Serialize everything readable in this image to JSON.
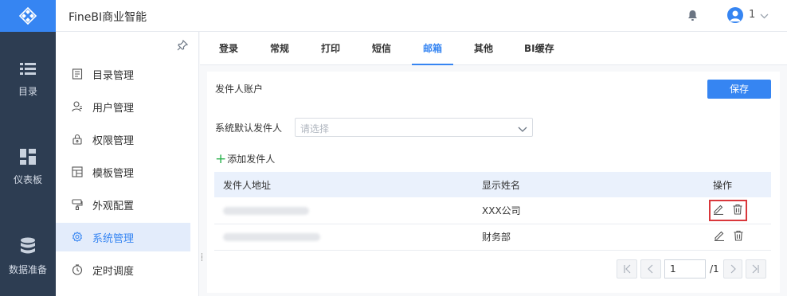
{
  "app": {
    "title": "FineBI商业智能"
  },
  "user": {
    "name": "1"
  },
  "rail": [
    {
      "label": "目录",
      "icon": "list-icon"
    },
    {
      "label": "仪表板",
      "icon": "dashboard-icon"
    },
    {
      "label": "数据准备",
      "icon": "database-icon"
    }
  ],
  "sidebar": {
    "items": [
      {
        "label": "目录管理",
        "icon": "directory-icon"
      },
      {
        "label": "用户管理",
        "icon": "user-icon"
      },
      {
        "label": "权限管理",
        "icon": "lock-icon"
      },
      {
        "label": "模板管理",
        "icon": "template-icon"
      },
      {
        "label": "外观配置",
        "icon": "brush-icon"
      },
      {
        "label": "系统管理",
        "icon": "gear-icon",
        "active": true
      },
      {
        "label": "定时调度",
        "icon": "clock-icon"
      }
    ]
  },
  "tabs": [
    {
      "label": "登录"
    },
    {
      "label": "常规"
    },
    {
      "label": "打印"
    },
    {
      "label": "短信"
    },
    {
      "label": "邮箱",
      "active": true
    },
    {
      "label": "其他"
    },
    {
      "label": "BI缓存"
    }
  ],
  "mail": {
    "section_title": "发件人账户",
    "save_label": "保存",
    "default_sender_label": "系统默认发件人",
    "default_sender_placeholder": "请选择",
    "add_sender_label": "添加发件人",
    "columns": {
      "address": "发件人地址",
      "display_name": "显示姓名",
      "actions": "操作"
    },
    "rows": [
      {
        "address": "",
        "display_name": "XXX公司"
      },
      {
        "address": "",
        "display_name": "财务部"
      }
    ],
    "pagination": {
      "current_page": "1",
      "total": "/1"
    }
  },
  "colors": {
    "accent": "#3685f2",
    "rail_bg": "#2d3d52",
    "highlight_box": "#d9373b",
    "add_plus": "#27b04a"
  }
}
